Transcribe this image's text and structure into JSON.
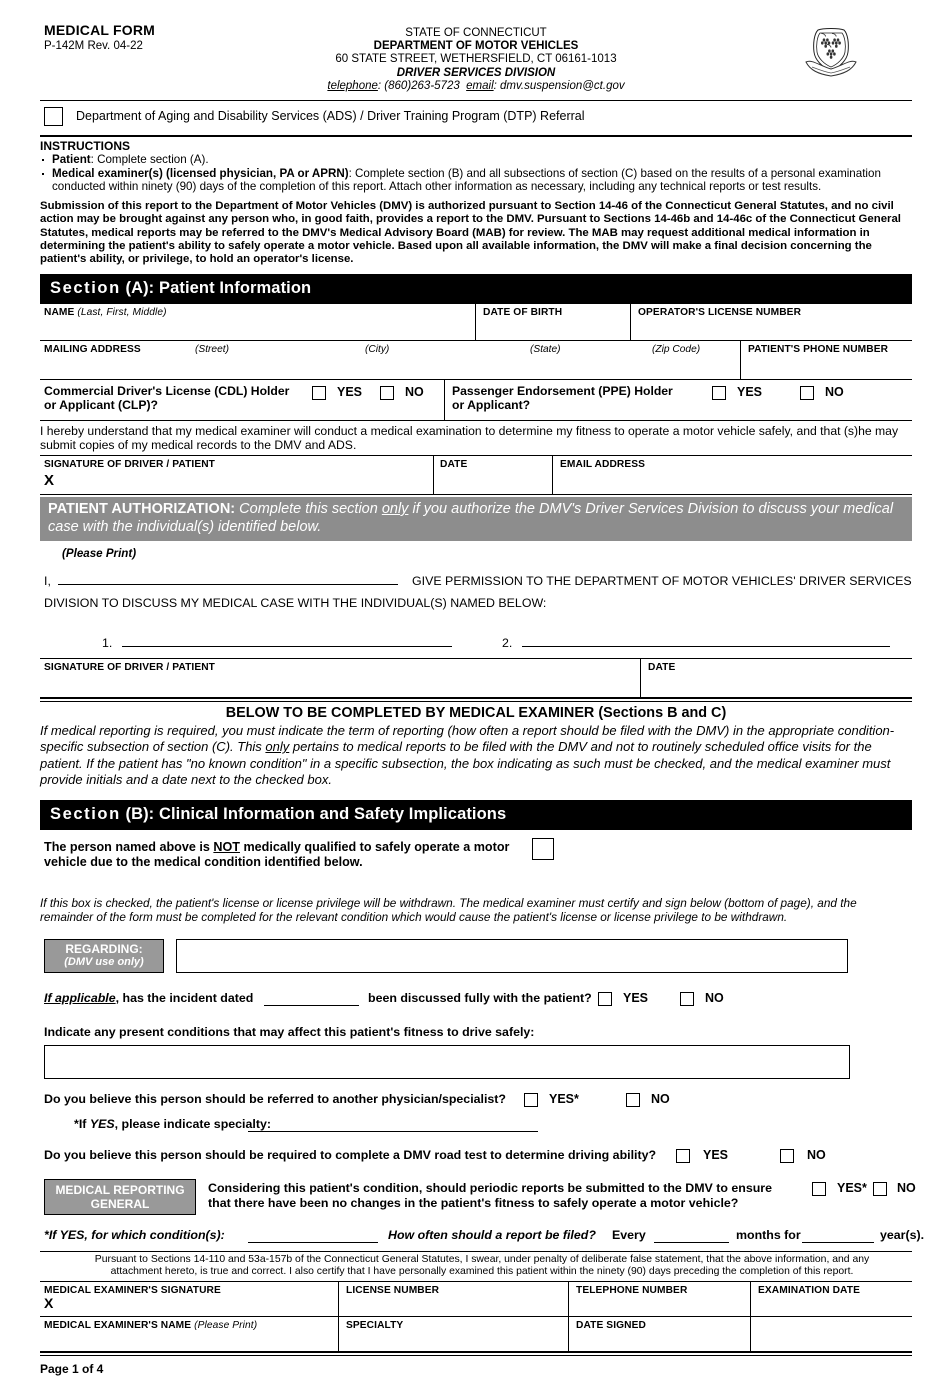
{
  "header": {
    "form_title": "MEDICAL FORM",
    "form_number": "P-142M Rev. 04-22",
    "state": "STATE OF CONNECTICUT",
    "department": "DEPARTMENT OF MOTOR VEHICLES",
    "address": "60 STATE STREET, WETHERSFIELD, CT 06161-1013",
    "division": "DRIVER SERVICES DIVISION",
    "telephone_label": "telephone",
    "telephone_value": ": (860)263-5723",
    "email_label": "email",
    "email_value": ": dmv.suspension@ct.gov",
    "seal_name": "connecticut-state-seal"
  },
  "referral": {
    "label": "Department of Aging and Disability Services (ADS) / Driver Training Program (DTP) Referral"
  },
  "instructions": {
    "title": "INSTRUCTIONS",
    "bullet1_bold": "Patient",
    "bullet1_rest": ": Complete section (A).",
    "bullet2_bold": "Medical examiner(s) (licensed physician, PA or APRN)",
    "bullet2_rest": ": Complete section (B) and all subsections of section (C) based on the results of a personal examination conducted within ninety (90) days of the completion of this report. Attach other information as necessary, including any technical reports or test results.",
    "paragraph": "Submission of this report to the Department of Motor Vehicles (DMV) is authorized pursuant to Section 14-46 of the Connecticut General Statutes, and no civil action may be brought against any person who, in good faith, provides a report to the DMV. Pursuant to Sections 14-46b and 14-46c of the Connecticut General Statutes, medical reports may be referred to the DMV's Medical Advisory Board (MAB) for review. The MAB may request additional medical information in determining the patient's ability to safely operate a motor vehicle. Based upon all available information, the DMV will make a final decision concerning the patient's ability, or privilege, to hold an operator's license."
  },
  "section_a": {
    "banner_prefix": "Section",
    "banner_rest": " (A): Patient Information",
    "name_label": "NAME",
    "name_hint": "(Last, First, Middle)",
    "dob_label": "DATE OF BIRTH",
    "license_label": "OPERATOR'S LICENSE NUMBER",
    "address_label": "MAILING ADDRESS",
    "street_hint": "(Street)",
    "city_hint": "(City)",
    "state_hint": "(State)",
    "zip_hint": "(Zip Code)",
    "phone_label": "PATIENT'S PHONE NUMBER",
    "cdl_line1": "Commercial Driver's License (CDL) Holder",
    "cdl_line2": "or Applicant (CLP)?",
    "ppe_line1": "Passenger Endorsement (PPE) Holder",
    "ppe_line2": "or Applicant?",
    "yes": "YES",
    "no": "NO",
    "consent": "I hereby understand that my medical examiner will conduct a medical examination to determine my fitness to operate a motor vehicle safely, and that (s)he may submit copies of my medical records to the DMV and ADS.",
    "sig_label": "SIGNATURE OF DRIVER / PATIENT",
    "sig_x": "X",
    "date_label": "DATE",
    "email_label": "EMAIL ADDRESS"
  },
  "patient_authorization": {
    "title": "PATIENT AUTHORIZATION:",
    "subtitle_a": "Complete this section ",
    "subtitle_only": "only",
    "subtitle_b": " if you authorize the DMV's Driver Services Division to discuss your medical case with the individual(s) identified below.",
    "please_print": "(Please Print)",
    "i_label": "I,",
    "permission_text": "GIVE PERMISSION TO THE DEPARTMENT OF MOTOR VEHICLES' DRIVER SERVICES",
    "division_text": "DIVISION TO DISCUSS MY MEDICAL CASE WITH THE INDIVIDUAL(S) NAMED BELOW:",
    "item1": "1.",
    "item2": "2.",
    "sig_label": "SIGNATURE OF DRIVER / PATIENT",
    "date_label": "DATE"
  },
  "below_block": {
    "title": "BELOW TO BE COMPLETED BY MEDICAL EXAMINER (Sections B and C)",
    "para_a": "If medical reporting is required, you must indicate the term of reporting (how often a report should be filed with the DMV) in the appropriate condition-specific subsection of section (C).  This ",
    "para_only": "only",
    "para_b": " pertains to medical reports to be filed with the DMV and not to routinely scheduled office visits for the patient.  If the patient has \"no known condition\" in a specific subsection, the box indicating as such must be checked, and the medical examiner must provide initials and a date next to the checked box."
  },
  "section_b": {
    "banner_prefix": "Section",
    "banner_rest": " (B): Clinical Information and Safety Implications",
    "notqual_a": "The person named above is ",
    "notqual_not": "NOT",
    "notqual_b": " medically qualified to safely operate a motor vehicle due to the medical condition identified below.",
    "withdraw_note": "If this box is checked, the patient's license or license privilege will be withdrawn.  The medical examiner must certify and sign below (bottom of page), and the remainder of the form must be completed for the relevant condition which would cause the patient's license or license privilege to be withdrawn.",
    "regarding_l1": "REGARDING:",
    "regarding_l2": "(DMV use only)",
    "regarding_value": "",
    "incident_a": "If applicable",
    "incident_b": ", has the incident dated",
    "incident_c": "been discussed fully with the patient?",
    "yes": "YES",
    "no": "NO",
    "conditions_prompt": "Indicate any present conditions that may affect this patient's fitness to drive safely:",
    "conditions_value": "",
    "referral_q": "Do you believe this person should be referred to another physician/specialist?",
    "yes_star": "YES*",
    "specialty_a": "*If ",
    "specialty_yes": "YES",
    "specialty_b": ", please indicate specialty:",
    "roadtest_q": "Do you believe this person should be required to complete a DMV road test to determine driving ability?",
    "medrep_l1": "MEDICAL REPORTING",
    "medrep_l2": "GENERAL",
    "medrep_q1": "Considering this patient's condition, should periodic reports be submitted to the DMV to ensure",
    "medrep_q2": "that there have been no changes in the patient's fitness to safely operate a motor vehicle?",
    "ifyes_cond": "*If YES, for which condition(s):",
    "howoften": "How often should a report be filed?",
    "every": "Every",
    "months_for": "months for",
    "years": "year(s)."
  },
  "certification": {
    "text": "Pursuant to Sections 14-110 and 53a-157b of the Connecticut General Statutes, I swear, under penalty of deliberate false statement, that the above information, and any attachment hereto, is true and correct. I also certify that I have personally examined this patient within the ninety (90) days preceding the completion of this report."
  },
  "examiner_table": {
    "signature_label": "MEDICAL EXAMINER'S SIGNATURE",
    "signature_x": "X",
    "license_label": "LICENSE NUMBER",
    "telephone_label": "TELEPHONE NUMBER",
    "exam_date_label": "EXAMINATION DATE",
    "name_label": "MEDICAL EXAMINER'S NAME",
    "name_hint": "(Please Print)",
    "specialty_label": "SPECIALTY",
    "date_signed_label": "DATE SIGNED"
  },
  "footer": {
    "page": "Page 1 of 4"
  },
  "colors": {
    "banner_black": "#000000",
    "banner_gray": "#8d8d8d",
    "tag_gray": "#999999",
    "paper": "#ffffff",
    "ink": "#000000"
  }
}
